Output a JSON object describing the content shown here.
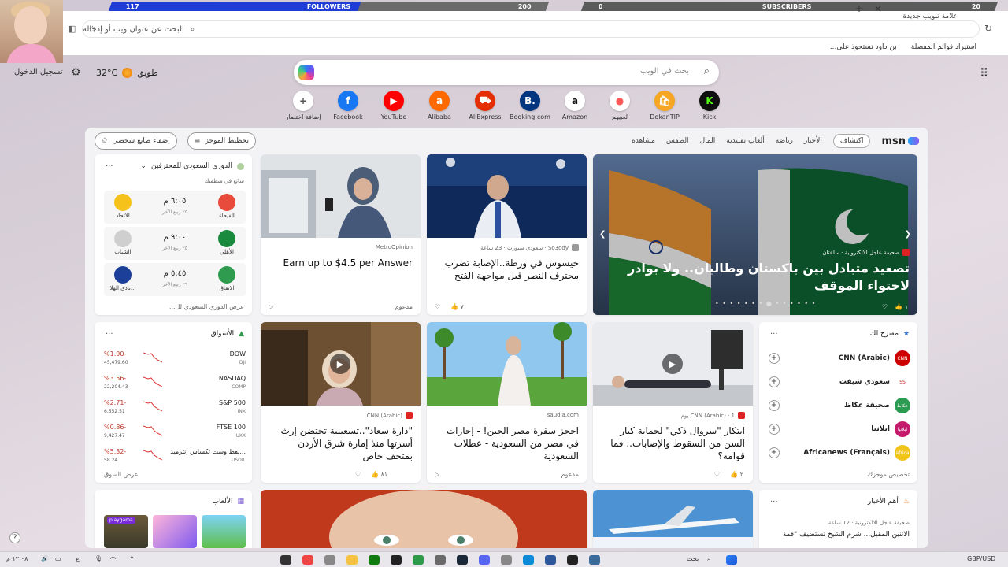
{
  "stream": {
    "followers_label": "FOLLOWERS",
    "followers_count": "117",
    "followers_goal": "200",
    "followers_progress": 0.585,
    "subscribers_label": "SUBSCRIBERS",
    "subscribers_count": "0",
    "subscribers_goal": "20"
  },
  "browser": {
    "new_tab_label": "علامة تبويب جديدة",
    "address_placeholder": "البحث عن عنوان ويب أو إدخاله",
    "bookmarks": [
      "استيراد قوائم المفضلة",
      "بن داود تستحوذ على..."
    ]
  },
  "header": {
    "signin_label": "تسجيل الدخول",
    "weather_city": "طويق",
    "weather_temp": "32°C",
    "search_placeholder": "بحث في الويب"
  },
  "quicklinks": [
    {
      "label": "Kick",
      "color": "#0e0e0e",
      "glyph": "K",
      "fg": "#53fc18"
    },
    {
      "label": "DokanTIP",
      "color": "#f5a623",
      "glyph": "🛍",
      "fg": "#fff"
    },
    {
      "label": "لعبيهم",
      "color": "#ffffff",
      "glyph": "●",
      "fg": "#ff5a5a"
    },
    {
      "label": "Amazon",
      "color": "#ffffff",
      "glyph": "a",
      "fg": "#111"
    },
    {
      "label": "Booking.com",
      "color": "#003580",
      "glyph": "B.",
      "fg": "#fff"
    },
    {
      "label": "AliExpress",
      "color": "#e62e04",
      "glyph": "⛟",
      "fg": "#fff"
    },
    {
      "label": "Alibaba",
      "color": "#ff6a00",
      "glyph": "a",
      "fg": "#fff"
    },
    {
      "label": "YouTube",
      "color": "#ff0000",
      "glyph": "▶",
      "fg": "#fff"
    },
    {
      "label": "Facebook",
      "color": "#1877f2",
      "glyph": "f",
      "fg": "#fff"
    },
    {
      "label": "إضافة اختصار",
      "color": "#ffffff",
      "glyph": "+",
      "fg": "#555"
    }
  ],
  "feed_controls": {
    "personalize_label": "تخطيط الموجز",
    "focus_label": "إضفاء طابع شخصي"
  },
  "msn_nav": {
    "logo": "msn",
    "items": [
      "اكتشاف",
      "الأخبار",
      "رياضة",
      "ألعاب تقليدية",
      "المال",
      "الطقس",
      "مشاهدة"
    ]
  },
  "sports_widget": {
    "title": "الدوري السعودي للمحترفين",
    "subtitle": "شائع في منطقتك",
    "matches": [
      {
        "home": "الفيحاء",
        "away": "الاتحاد",
        "time": "٦:٠٥ م",
        "date": "٢٥ ربيع الآخر",
        "home_color": "#e84b3c",
        "away_color": "#f4c21a"
      },
      {
        "home": "الأهلي",
        "away": "الشباب",
        "time": "٩:٠٠ م",
        "date": "٢٥ ربيع الآخر",
        "home_color": "#1a8a3e",
        "away_color": "#cfcfcf"
      },
      {
        "home": "الاتفاق",
        "away": "نادي الهلا...",
        "time": "٥:٤٥ م",
        "date": "٢٦ ربيع الآخر",
        "home_color": "#2e9b4f",
        "away_color": "#1c3f9a"
      }
    ],
    "footer": "عرض الدوري السعودي لل..."
  },
  "markets_widget": {
    "title": "الأسواق",
    "rows": [
      {
        "name": "DOW",
        "sub": "DJI",
        "change": "%1.90-",
        "price": "45,479.60"
      },
      {
        "name": "NASDAQ",
        "sub": "COMP",
        "change": "%3.56-",
        "price": "22,204.43"
      },
      {
        "name": "S&P 500",
        "sub": "INX",
        "change": "%2.71-",
        "price": "6,552.51"
      },
      {
        "name": "FTSE 100",
        "sub": "UKX",
        "change": "%0.86-",
        "price": "9,427.47"
      },
      {
        "name": "نفط وست تكساس إنترميد...",
        "sub": "USOIL",
        "change": "%5.32-",
        "price": "58.24"
      }
    ],
    "footer": "عرض السوق"
  },
  "suggest_widget": {
    "title": "مقترح لك",
    "items": [
      {
        "name": "CNN (Arabic)",
        "color": "#cc0000",
        "tag": "CNN"
      },
      {
        "name": "سعودي شيفت",
        "color": "#ffffff",
        "tag": "SS"
      },
      {
        "name": "صحيفة عكاظ",
        "color": "#2c9b52",
        "tag": "عكاظ"
      },
      {
        "name": "ايلانيا",
        "color": "#c41a6b",
        "tag": "ايلانيا"
      },
      {
        "name": "Africanews (Français)",
        "color": "#f0c419",
        "tag": "africa"
      }
    ],
    "footer": "تخصيص موجزك"
  },
  "games_widget": {
    "title": "الألعاب",
    "badge": "playgama"
  },
  "news_widget": {
    "title": "أهم الأخبار",
    "source": "صحيفة عاجل الالكترونية · 12 ساعة",
    "headline": "الاثنين المقبل... شرم الشيخ تستضيف \"قمة"
  },
  "cards": {
    "hero": {
      "source": "صحيفة عاجل الالكترونية · ساعتان",
      "title": "تصعيد متبادل بين باكستان وطالبان.. ولا بوادر لاحتواء الموقف",
      "likes": "١"
    },
    "jesus": {
      "source": "So3ody · سعودي سبورت · 23 ساعة",
      "title": "خيسوس في ورطة..الإصابة تضرب محترف النصر قبل مواجهة الفتح",
      "likes": "٧"
    },
    "ad": {
      "source": "MetroOpinion",
      "title": "Earn up to $4.5 per Answer",
      "foot": "مدعوم"
    },
    "trousers": {
      "source": "CNN (Arabic) · 1 يوم",
      "title": "ابتكار \"سروال ذكي\" لحماية كبار السن من السقوط والإصابات.. فما قوامه؟",
      "likes": "٢"
    },
    "egypt": {
      "source": "saudia.com",
      "title": "احجز سفرة مصر الجين! - إجازات في مصر من السعودية - عطلات السعودية",
      "foot": "مدعوم"
    },
    "saad": {
      "source": "CNN (Arabic)",
      "title": "\"دارة سعاد\"..تسعينية تحتضن إرث أسرتها منذ إمارة شرق الأردن بمتحف خاص",
      "likes": "٨١"
    }
  },
  "taskbar": {
    "search_label": "بحث",
    "currency": "GBP/USD",
    "currency_change": "+٣٠٪",
    "clock_time": "١٢:٠٨ م",
    "clock_date": "٢٧/١٠/..."
  }
}
